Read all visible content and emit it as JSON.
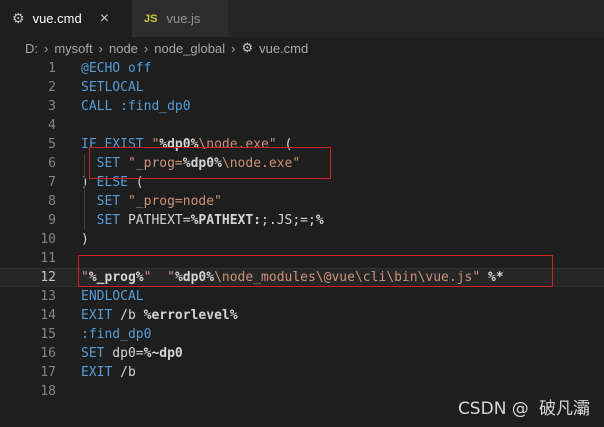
{
  "tabs": [
    {
      "label": "vue.cmd",
      "icon": "gear-icon",
      "active": true,
      "close": "×"
    },
    {
      "label": "vue.js",
      "icon": "js-icon",
      "icon_text": "JS",
      "active": false
    }
  ],
  "breadcrumb": [
    "D:",
    "mysoft",
    "node",
    "node_global",
    "vue.cmd"
  ],
  "breadcrumb_sep": "›",
  "editor": {
    "current_line": 12,
    "lines": [
      {
        "n": "1",
        "tokens": [
          [
            "kw",
            "@ECHO off"
          ]
        ]
      },
      {
        "n": "2",
        "tokens": [
          [
            "kw",
            "SETLOCAL"
          ]
        ]
      },
      {
        "n": "3",
        "tokens": [
          [
            "kw",
            "CALL"
          ],
          [
            "plain",
            " "
          ],
          [
            "kw",
            ":find_dp0"
          ]
        ]
      },
      {
        "n": "4",
        "tokens": []
      },
      {
        "n": "5",
        "tokens": [
          [
            "kw",
            "IF EXIST"
          ],
          [
            "plain",
            " "
          ],
          [
            "str",
            "\""
          ],
          [
            "var",
            "%dp0%"
          ],
          [
            "str",
            "\\node.exe\""
          ],
          [
            "plain",
            " ("
          ]
        ]
      },
      {
        "n": "6",
        "tokens": [
          [
            "plain",
            "  "
          ],
          [
            "kw",
            "SET"
          ],
          [
            "plain",
            " "
          ],
          [
            "str",
            "\"_prog="
          ],
          [
            "var",
            "%dp0%"
          ],
          [
            "str",
            "\\node.exe\""
          ]
        ]
      },
      {
        "n": "7",
        "tokens": [
          [
            "plain",
            ") "
          ],
          [
            "kw",
            "ELSE"
          ],
          [
            "plain",
            " ("
          ]
        ]
      },
      {
        "n": "8",
        "tokens": [
          [
            "plain",
            "  "
          ],
          [
            "kw",
            "SET"
          ],
          [
            "plain",
            " "
          ],
          [
            "str",
            "\"_prog=node\""
          ]
        ]
      },
      {
        "n": "9",
        "tokens": [
          [
            "plain",
            "  "
          ],
          [
            "kw",
            "SET"
          ],
          [
            "plain",
            " PATHEXT="
          ],
          [
            "var",
            "%PATHEXT:"
          ],
          [
            "plain",
            ";.JS;=;"
          ],
          [
            "var",
            "%"
          ]
        ]
      },
      {
        "n": "10",
        "tokens": [
          [
            "plain",
            ")"
          ]
        ]
      },
      {
        "n": "11",
        "tokens": []
      },
      {
        "n": "12",
        "tokens": [
          [
            "str",
            "\""
          ],
          [
            "var",
            "%_prog%"
          ],
          [
            "str",
            "\""
          ],
          [
            "plain",
            "  "
          ],
          [
            "str",
            "\""
          ],
          [
            "var",
            "%dp0%"
          ],
          [
            "str",
            "\\node_modules\\@vue\\cli\\bin\\vue.js\""
          ],
          [
            "plain",
            " "
          ],
          [
            "var",
            "%*"
          ]
        ]
      },
      {
        "n": "13",
        "tokens": [
          [
            "kw",
            "ENDLOCAL"
          ]
        ]
      },
      {
        "n": "14",
        "tokens": [
          [
            "kw",
            "EXIT"
          ],
          [
            "plain",
            " /b "
          ],
          [
            "var",
            "%errorlevel%"
          ]
        ]
      },
      {
        "n": "15",
        "tokens": [
          [
            "kw",
            ":find_dp0"
          ]
        ]
      },
      {
        "n": "16",
        "tokens": [
          [
            "kw",
            "SET"
          ],
          [
            "plain",
            " dp0="
          ],
          [
            "var",
            "%~dp0"
          ]
        ]
      },
      {
        "n": "17",
        "tokens": [
          [
            "kw",
            "EXIT"
          ],
          [
            "plain",
            " /b"
          ]
        ]
      },
      {
        "n": "18",
        "tokens": []
      }
    ]
  },
  "watermark": "CSDN @   破凡灞",
  "colors": {
    "background": "#1e1e1e",
    "keyword": "#569cd6",
    "string": "#ce9178",
    "highlight_box": "#d02020"
  }
}
